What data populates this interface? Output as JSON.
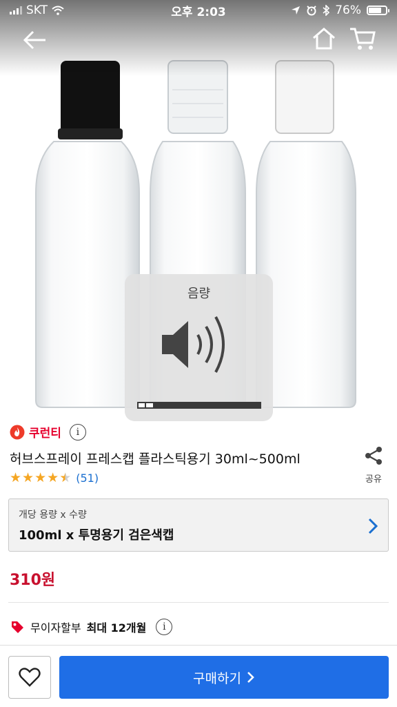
{
  "status_bar": {
    "carrier": "SKT",
    "time": "오후 2:03",
    "battery": "76%",
    "battery_level": 0.76
  },
  "nav": {
    "back_icon": "back-arrow-icon",
    "home_icon": "home-icon",
    "cart_icon": "cart-icon"
  },
  "volume_hud": {
    "title": "음량",
    "icon": "speaker-volume-icon",
    "level": 0.12
  },
  "product": {
    "brand": "쿠런티",
    "brand_icon": "flame-badge-icon",
    "title": "허브스프레이 프레스캡 플라스틱용기 30ml~500ml",
    "share_label": "공유",
    "rating": 4.5,
    "review_count": "(51)"
  },
  "option": {
    "label": "개당 용량 x 수량",
    "value": "100ml x 투명용기 검은색캡"
  },
  "price": "310원",
  "installment": {
    "prefix": "무이자할부",
    "highlight": "최대 12개월"
  },
  "bottom": {
    "buy_label": "구매하기",
    "buy_arrow": "›"
  },
  "colors": {
    "brand_red": "#e6002d",
    "price_red": "#c8102e",
    "link_blue": "#1a6fd0",
    "buy_blue": "#1f6ee6",
    "star": "#f5a623"
  }
}
